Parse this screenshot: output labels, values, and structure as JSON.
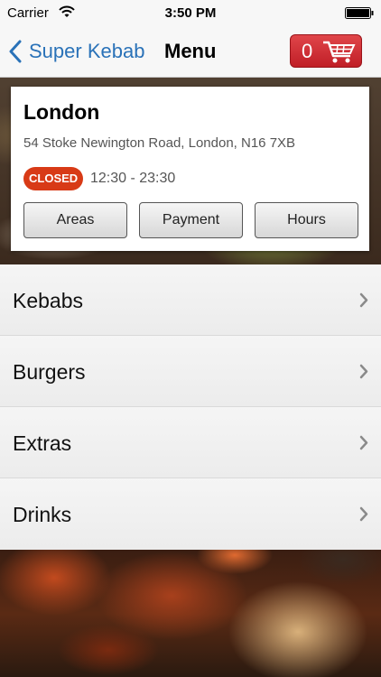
{
  "status_bar": {
    "carrier": "Carrier",
    "time": "3:50 PM",
    "icons": [
      "wifi-icon",
      "battery-icon"
    ]
  },
  "nav": {
    "back_label": "Super Kebab",
    "title": "Menu",
    "cart_count": "0",
    "accent_color": "#2a72b8",
    "cart_color": "#c01e26"
  },
  "store": {
    "city": "London",
    "address": "54 Stoke Newington Road, London, N16 7XB",
    "status_badge": "CLOSED",
    "status_color": "#d83a16",
    "hours": "12:30 - 23:30",
    "buttons": [
      "Areas",
      "Payment",
      "Hours"
    ]
  },
  "menu": {
    "items": [
      {
        "label": "Kebabs"
      },
      {
        "label": "Burgers"
      },
      {
        "label": "Extras"
      },
      {
        "label": "Drinks"
      }
    ]
  }
}
